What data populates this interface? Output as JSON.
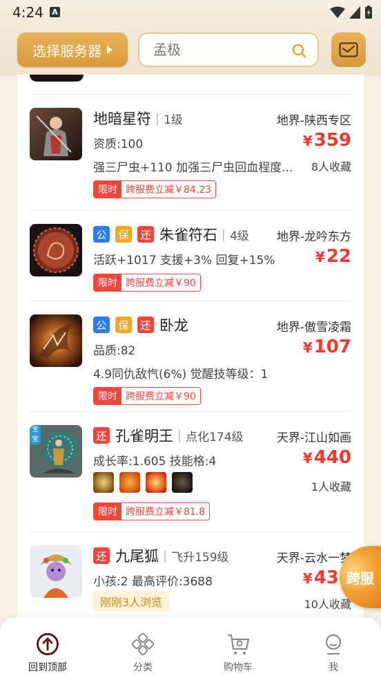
{
  "status_bar": {
    "time": "4:24",
    "notif_glyph": "A"
  },
  "header": {
    "server_button_label": "选择服务器",
    "search_placeholder": "孟极",
    "colors": {
      "accent": "#d89a3a",
      "price": "#ef3a2d"
    }
  },
  "listings": [
    {
      "name": "地暗星符",
      "level": "1级",
      "server": "地界-陕西专区",
      "lines": [
        "资质:100",
        "强三尸虫+110 加强三尸虫回血程度..."
      ],
      "price": "359",
      "favorites": "8人收藏",
      "promo": {
        "tag": "限时",
        "text": "跨服费立减￥84.23"
      },
      "tags": [],
      "thumb_icon": "warrior-avatar-icon"
    },
    {
      "name": "朱雀符石",
      "level": "4级",
      "server": "地界-龙吟东方",
      "lines": [
        "活跃+1017 支援+3% 回复+15%"
      ],
      "price": "22",
      "favorites": "",
      "promo": {
        "tag": "限时",
        "text": "跨服费立减￥90"
      },
      "tags": [
        "公",
        "保",
        "还"
      ],
      "thumb_icon": "phoenix-stone-icon"
    },
    {
      "name": "卧龙",
      "level": "",
      "server": "地界-傲雪凌霜",
      "lines": [
        "品质:82",
        "4.9同仇敌忾(6%) 觉醒技等级：1"
      ],
      "price": "107",
      "favorites": "",
      "promo": {
        "tag": "限时",
        "text": "跨服费立减￥90"
      },
      "tags": [
        "公",
        "保",
        "还"
      ],
      "thumb_icon": "dragon-claw-icon"
    },
    {
      "name": "孔雀明王",
      "level": "点化174级",
      "server": "天界-江山如画",
      "lines": [
        "成长率:1.605 技能格:4"
      ],
      "price": "440",
      "favorites": "1人收藏",
      "promo": {
        "tag": "限时",
        "text": "跨服费立减￥81.8"
      },
      "tags": [
        "还"
      ],
      "thumb_icon": "peacock-king-icon",
      "thumb_badge": "宝宝"
    },
    {
      "name": "九尾狐",
      "level": "飞升159级",
      "server": "天界-云水一梦",
      "lines": [
        "小孩:2 最高评价:3688"
      ],
      "price": "430",
      "favorites": "10人收藏",
      "viewed": "刚刚3人浏览",
      "tags": [
        "还"
      ],
      "thumb_icon": "nine-tail-fox-icon"
    }
  ],
  "floating_badge": "跨服",
  "bottom_nav": [
    {
      "label": "回到顶部",
      "icon": "arrow-up-circle-icon",
      "active": true
    },
    {
      "label": "分类",
      "icon": "category-icon",
      "active": false
    },
    {
      "label": "购物车",
      "icon": "cart-icon",
      "active": false
    },
    {
      "label": "我",
      "icon": "profile-icon",
      "active": false
    }
  ]
}
